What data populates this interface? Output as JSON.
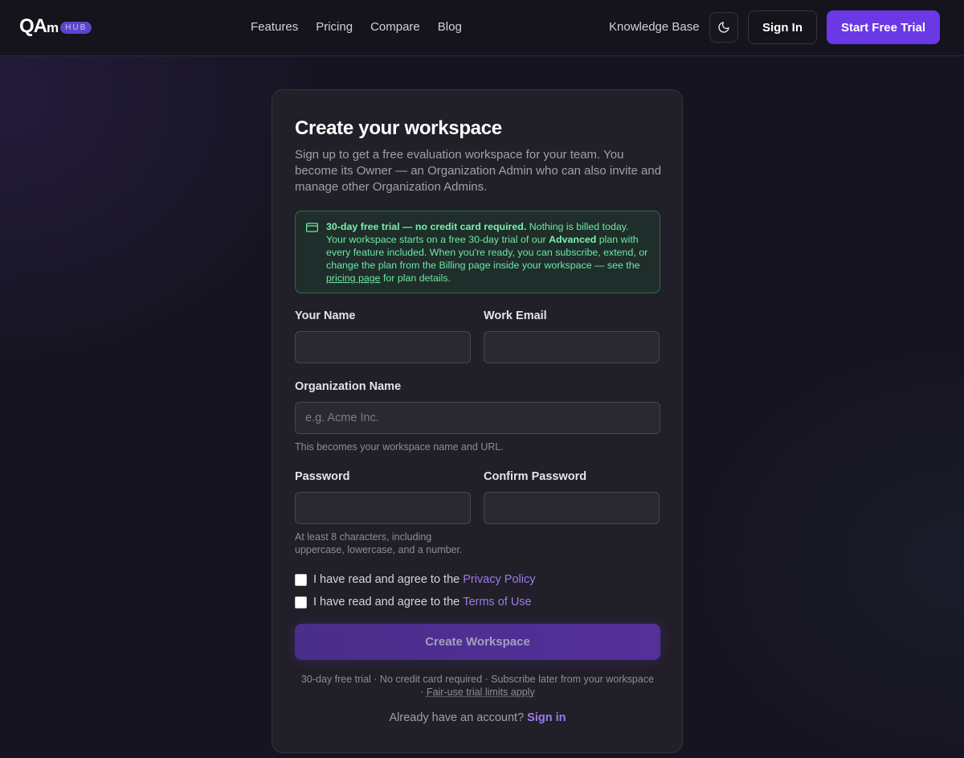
{
  "header": {
    "logo_text": "QAm",
    "logo_badge": "HUB",
    "nav": [
      "Features",
      "Pricing",
      "Compare",
      "Blog"
    ],
    "knowledge_base": "Knowledge Base",
    "theme_icon": "moon-icon",
    "sign_in": "Sign In",
    "start_trial": "Start Free Trial"
  },
  "card": {
    "title": "Create your workspace",
    "subtitle": "Sign up to get a free evaluation workspace for your team. You become its Owner — an Organization Admin who can also invite and manage other Organization Admins.",
    "notice": {
      "icon": "credit-card-icon",
      "bold_lead": "30-day free trial — no credit card required.",
      "text1": " Nothing is billed today. Your workspace starts on a free 30-day trial of our ",
      "plan": "Advanced",
      "text2": " plan with every feature included. When you're ready, you can subscribe, extend, or change the plan from the Billing page inside your workspace — see the ",
      "link": "pricing page",
      "text3": " for plan details."
    },
    "fields": {
      "name_label": "Your Name",
      "name_value": "",
      "email_label": "Work Email",
      "email_value": "",
      "org_label": "Organization Name",
      "org_placeholder": "e.g. Acme Inc.",
      "org_hint": "This becomes your workspace name and URL.",
      "password_label": "Password",
      "password_hint": "At least 8 characters, including uppercase, lowercase, and a number.",
      "confirm_label": "Confirm Password"
    },
    "consents": [
      {
        "text": "I have read and agree to the",
        "link": "Privacy Policy",
        "checked": false
      },
      {
        "text": "I have read and agree to the",
        "link": "Terms of Use",
        "checked": false
      }
    ],
    "create_button": "Create Workspace",
    "footer_line1": "30-day free trial · No credit card required · Subscribe later from your workspace",
    "footer_sep": "· ",
    "footer_link": "Fair-use trial limits apply",
    "already_text": "Already have an account?",
    "already_link": "Sign in"
  },
  "colors": {
    "accent": "#6b38e6",
    "link": "#9b7bf0",
    "notice_green": "#6ee7a6"
  }
}
